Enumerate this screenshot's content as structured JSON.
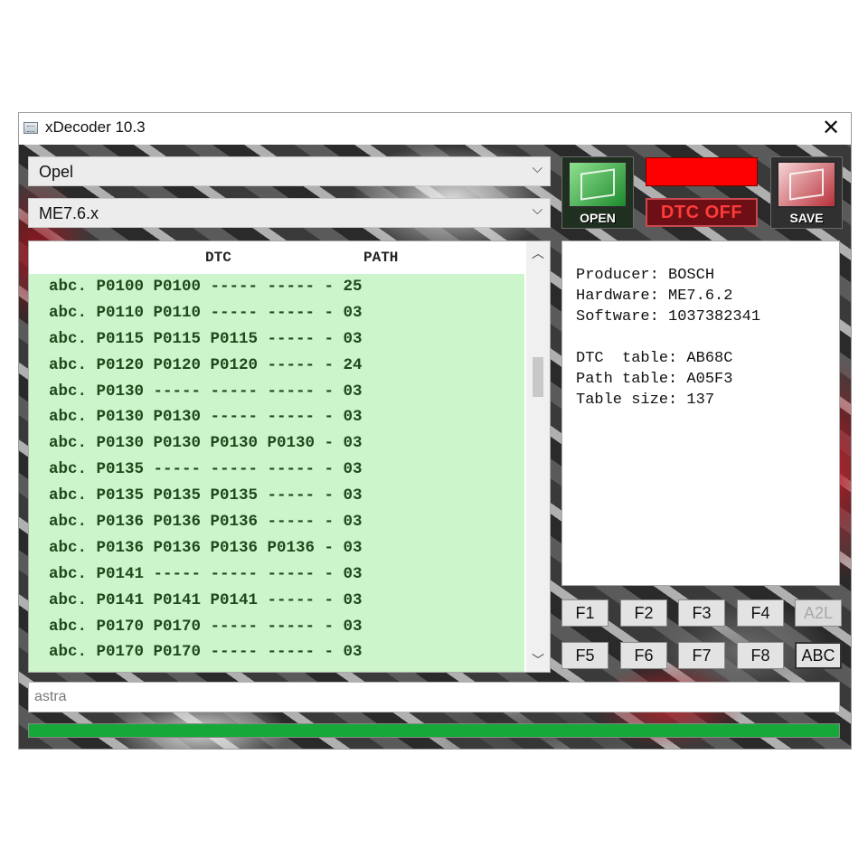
{
  "window": {
    "title": "xDecoder 10.3",
    "close_glyph": "✕"
  },
  "selectors": {
    "make": "Opel",
    "ecu": "ME7.6.x"
  },
  "toolbar": {
    "open_label": "OPEN",
    "save_label": "SAVE",
    "dtc_off_label": "DTC OFF",
    "indicator_color": "#ff0000"
  },
  "dtc_table": {
    "headers": {
      "dtc": "DTC",
      "path": "PATH"
    },
    "rows": [
      "abc. P0100 P0100 ----- ----- - 25",
      "abc. P0110 P0110 ----- ----- - 03",
      "abc. P0115 P0115 P0115 ----- - 03",
      "abc. P0120 P0120 P0120 ----- - 24",
      "abc. P0130 ----- ----- ----- - 03",
      "abc. P0130 P0130 ----- ----- - 03",
      "abc. P0130 P0130 P0130 P0130 - 03",
      "abc. P0135 ----- ----- ----- - 03",
      "abc. P0135 P0135 P0135 ----- - 03",
      "abc. P0136 P0136 P0136 ----- - 03",
      "abc. P0136 P0136 P0136 P0136 - 03",
      "abc. P0141 ----- ----- ----- - 03",
      "abc. P0141 P0141 P0141 ----- - 03",
      "abc. P0170 P0170 ----- ----- - 03",
      "abc. P0170 P0170 ----- ----- - 03"
    ],
    "row_bg": "#ccf5cc"
  },
  "info": {
    "producer": "Producer: BOSCH",
    "hardware": "Hardware: ME7.6.2",
    "software": "Software: 1037382341",
    "dtc_table": "DTC  table: AB68C",
    "path_table": "Path table: A05F3",
    "table_size": "Table size: 137"
  },
  "function_keys": {
    "f1": "F1",
    "f2": "F2",
    "f3": "F3",
    "f4": "F4",
    "a2l": "A2L",
    "f5": "F5",
    "f6": "F6",
    "f7": "F7",
    "f8": "F8",
    "abc": "ABC"
  },
  "search": {
    "value": "astra"
  },
  "progress": {
    "fraction": 1.0,
    "color": "#17a83a"
  },
  "icons": {
    "app": "app-window-icon",
    "close": "close-icon",
    "dropdown": "chevron-down-icon",
    "scroll_up": "chevron-up-icon",
    "scroll_down": "chevron-down-icon"
  }
}
